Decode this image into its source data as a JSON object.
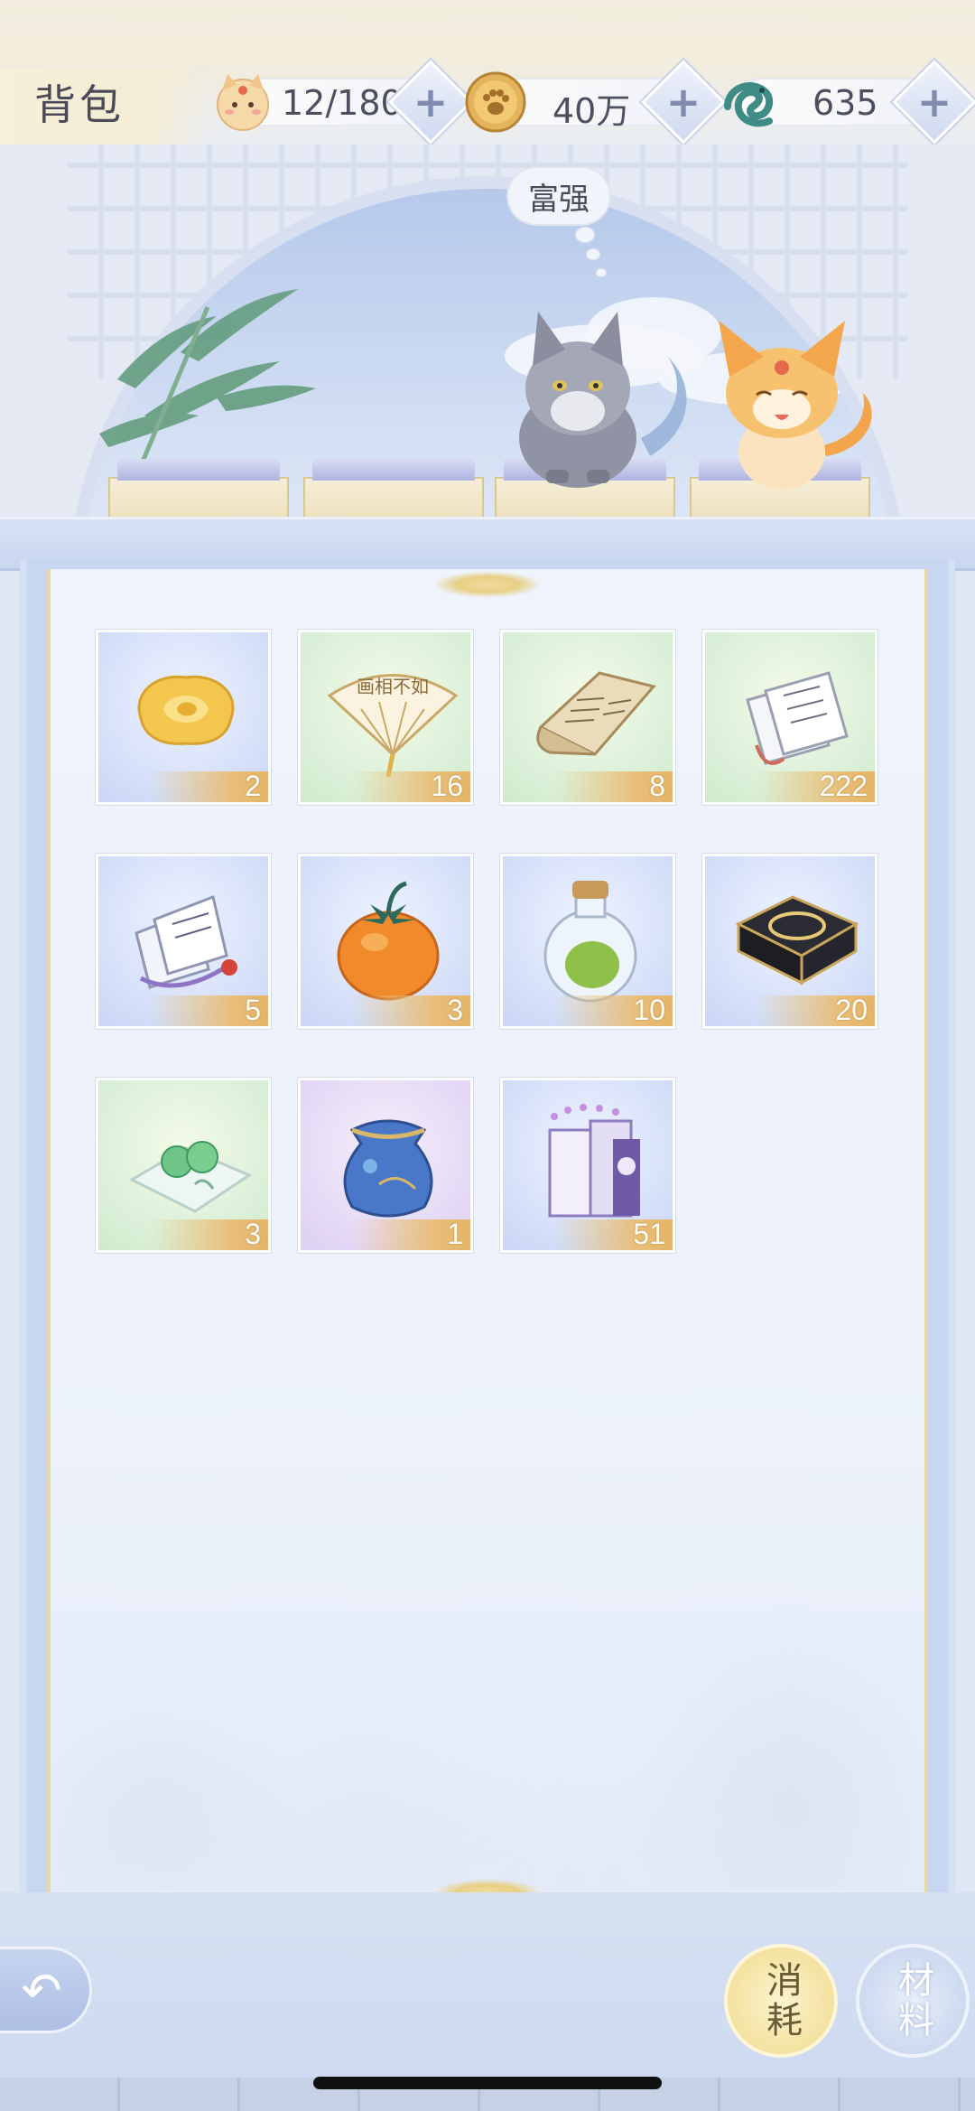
{
  "header": {
    "title": "背包",
    "resources": [
      {
        "icon": "cat-face-icon",
        "value": "12/180"
      },
      {
        "icon": "paw-coin-icon",
        "value": "40万"
      },
      {
        "icon": "jade-dragon-icon",
        "value": "635"
      }
    ],
    "plus_label": "+"
  },
  "scene": {
    "thought_bubble": "富强"
  },
  "inventory": {
    "items": [
      {
        "icon": "golden-rose-icon",
        "count": "2",
        "bg": "blue"
      },
      {
        "icon": "folding-fan-icon",
        "count": "16",
        "bg": "green"
      },
      {
        "icon": "scroll-book-icon",
        "count": "8",
        "bg": "green"
      },
      {
        "icon": "letter-pages-icon",
        "count": "222",
        "bg": "green"
      },
      {
        "icon": "talisman-pages-icon",
        "count": "5",
        "bg": "blue"
      },
      {
        "icon": "persimmon-fruit-icon",
        "count": "3",
        "bg": "blue"
      },
      {
        "icon": "potion-bottle-icon",
        "count": "10",
        "bg": "blue"
      },
      {
        "icon": "black-gift-box-icon",
        "count": "20",
        "bg": "blue"
      },
      {
        "icon": "jade-beads-cloth-icon",
        "count": "3",
        "bg": "green"
      },
      {
        "icon": "blue-pouch-icon",
        "count": "1",
        "bg": "purple"
      },
      {
        "icon": "music-score-books-icon",
        "count": "51",
        "bg": "blue"
      }
    ]
  },
  "bottom": {
    "back_icon": "back-arrow-icon",
    "tabs": [
      {
        "label": "消耗",
        "active": true
      },
      {
        "label": "材料",
        "active": false
      }
    ]
  },
  "colors": {
    "count_bar": "#e9bf78",
    "panel_bg": "#eef3fc",
    "active_tab": "#f3e29f"
  }
}
